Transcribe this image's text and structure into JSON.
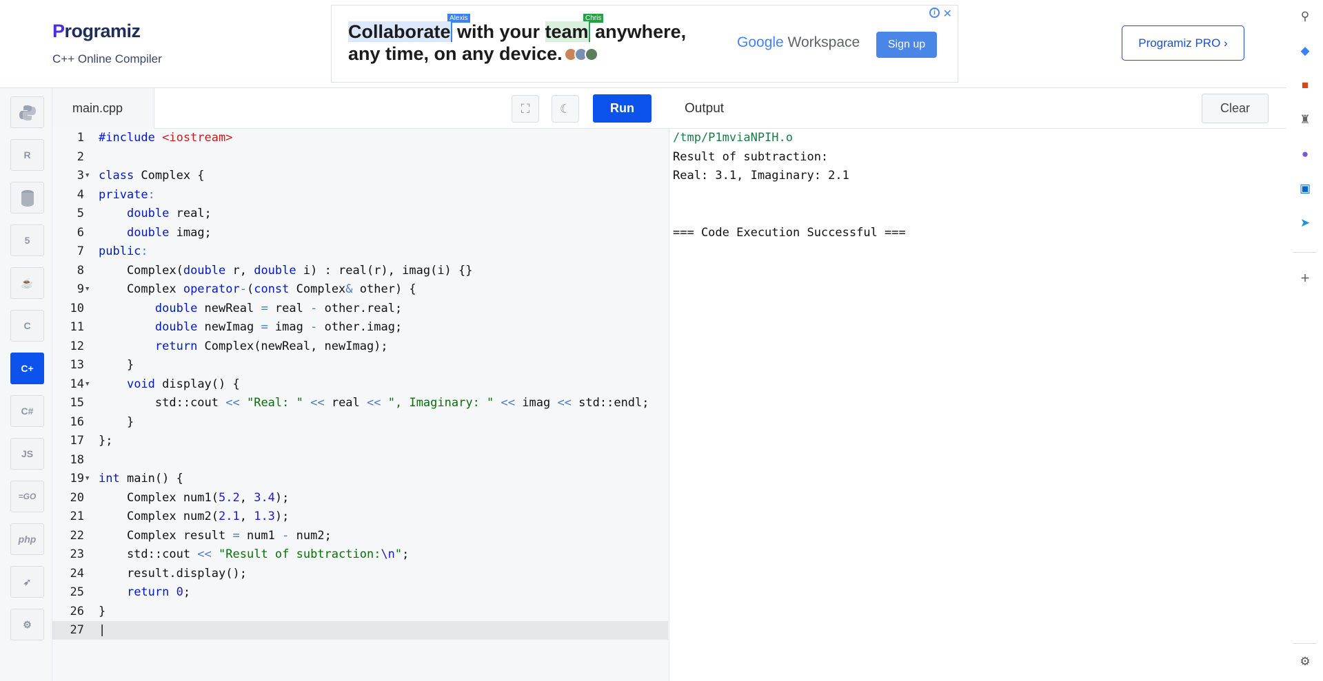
{
  "header": {
    "logo_text": "rogramiz",
    "logo_initial": "P",
    "subtitle": "C++ Online Compiler",
    "pro_button": "Programiz PRO ›"
  },
  "ad": {
    "word1": "Collaborate",
    "word2": " with your ",
    "word3": "team",
    "word4": " anywhere,",
    "line2": "any time, on any device.",
    "tag1": "Alexis",
    "tag2": "Chris",
    "brand_google": "Google",
    "brand_workspace": " Workspace",
    "signup": "Sign up",
    "close": "✕",
    "info": "i"
  },
  "languages": [
    "python",
    "r",
    "sql",
    "html",
    "java",
    "c",
    "cpp",
    "csharp",
    "js",
    "go",
    "php",
    "swift",
    "rust"
  ],
  "lang_labels": {
    "js": "JS",
    "go": "=GO",
    "php": "php"
  },
  "editor": {
    "tab": "main.cpp",
    "run": "Run",
    "lines": [
      "1",
      "2",
      "3",
      "4",
      "5",
      "6",
      "7",
      "8",
      "9",
      "10",
      "11",
      "12",
      "13",
      "14",
      "15",
      "16",
      "17",
      "18",
      "19",
      "20",
      "21",
      "22",
      "23",
      "24",
      "25",
      "26",
      "27"
    ]
  },
  "output": {
    "title": "Output",
    "clear": "Clear",
    "lines": [
      "/tmp/P1mviaNPIH.o",
      "Result of subtraction:",
      "Real: 3.1, Imaginary: 2.1",
      "",
      "",
      "=== Code Execution Successful ==="
    ]
  },
  "colors": {
    "accent": "#0b53ec",
    "brand": "#4b2ee0"
  }
}
